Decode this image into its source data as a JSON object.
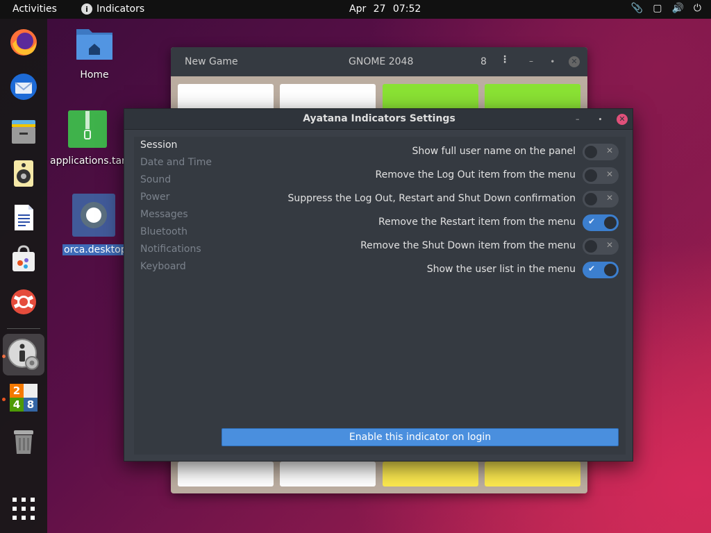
{
  "topbar": {
    "activities": "Activities",
    "indicators": "Indicators",
    "indicator_icon": "i",
    "clock": "Apr 27  07:52",
    "tray_icons": [
      "paperclip-icon",
      "screen-icon",
      "volume-icon",
      "power-icon"
    ]
  },
  "dock": {
    "items": [
      "firefox-icon",
      "thunderbird-icon",
      "files-icon",
      "rhythmbox-icon",
      "writer-icon",
      "software-icon",
      "help-icon",
      "indicator-settings-icon",
      "gnome-2048-icon",
      "trash-icon",
      "app-grid-icon"
    ],
    "game_tiles": [
      "2",
      "",
      "4",
      "8"
    ]
  },
  "desktop": {
    "icons": [
      {
        "label": "Home"
      },
      {
        "label": "applications.tar"
      },
      {
        "label": "orca.desktop"
      }
    ]
  },
  "game_window": {
    "new_game": "New Game",
    "title": "GNOME 2048",
    "score": "8",
    "colors": {
      "empty": "#ffffff",
      "green": "#8ae234",
      "yellow": "#fce94f"
    }
  },
  "settings_window": {
    "title": "Ayatana Indicators Settings",
    "sidebar": [
      {
        "label": "Session",
        "selected": true
      },
      {
        "label": "Date and Time",
        "selected": false
      },
      {
        "label": "Sound",
        "selected": false
      },
      {
        "label": "Power",
        "selected": false
      },
      {
        "label": "Messages",
        "selected": false
      },
      {
        "label": "Bluetooth",
        "selected": false
      },
      {
        "label": "Notifications",
        "selected": false
      },
      {
        "label": "Keyboard",
        "selected": false
      }
    ],
    "options": [
      {
        "label": "Show full user name on the panel",
        "on": false
      },
      {
        "label": "Remove the Log Out item from the menu",
        "on": false
      },
      {
        "label": "Suppress the Log Out, Restart and Shut Down confirmation",
        "on": false
      },
      {
        "label": "Remove the Restart item from the menu",
        "on": true
      },
      {
        "label": "Remove the Shut Down item from the menu",
        "on": false
      },
      {
        "label": "Show the user list in the menu",
        "on": true
      }
    ],
    "enable_button": "Enable this indicator on login",
    "accent_color": "#3c7fcf"
  }
}
